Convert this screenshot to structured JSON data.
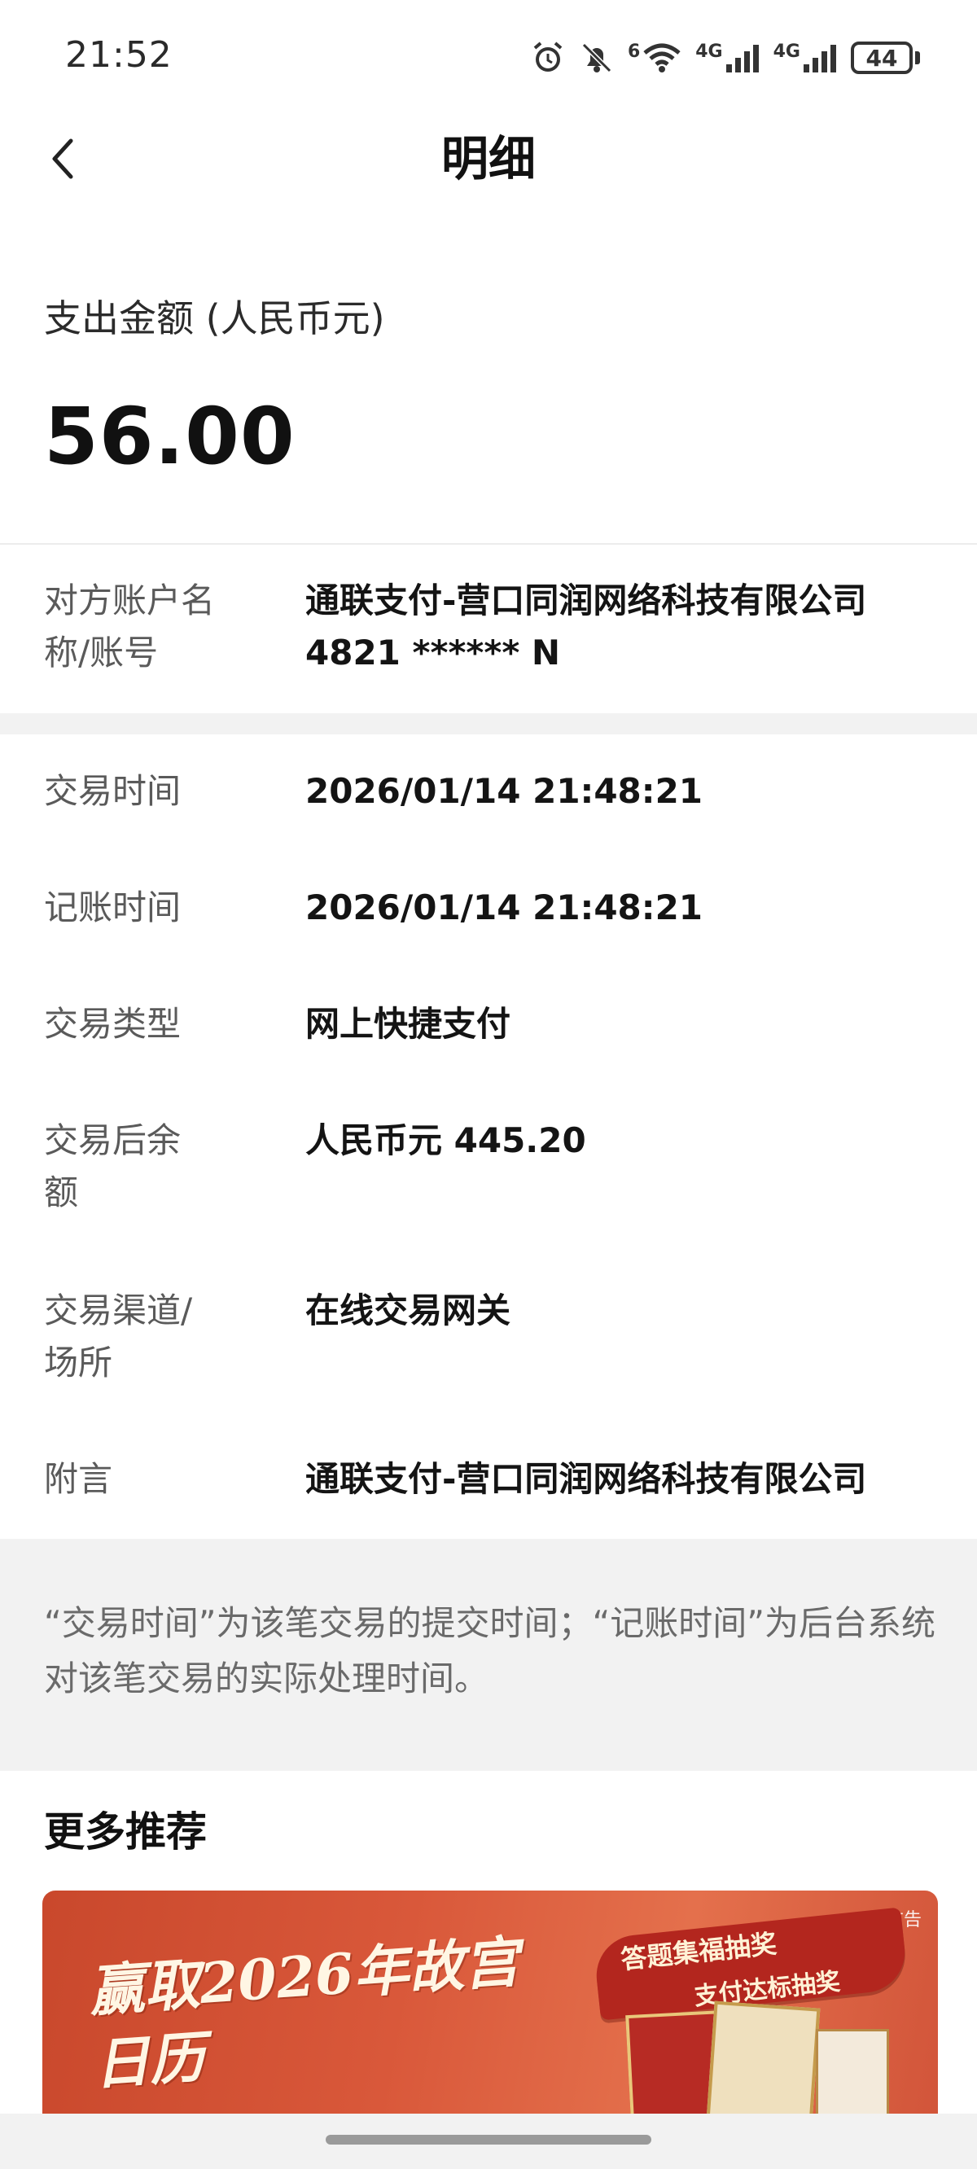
{
  "status_bar": {
    "time": "21:52",
    "icons": [
      "alarm-icon",
      "bell-off-icon",
      "wifi-icon",
      "signal-4g-icon",
      "signal-4g-icon",
      "battery-icon"
    ],
    "wifi_label": "6",
    "signal1_label": "4G",
    "signal2_label": "4G",
    "battery_level": "44"
  },
  "nav": {
    "back_icon": "chevron-left-icon",
    "title": "明细"
  },
  "amount": {
    "label": "支出金额 (人民币元)",
    "value": "56.00"
  },
  "counterparty": {
    "label": "对方账户名称/账号",
    "name": "通联支付-营口同润网络科技有限公司",
    "account": "4821 ****** N"
  },
  "details": [
    {
      "label": "交易时间",
      "value": "2026/01/14 21:48:21"
    },
    {
      "label": "记账时间",
      "value": "2026/01/14 21:48:21"
    },
    {
      "label": "交易类型",
      "value": "网上快捷支付"
    },
    {
      "label": "交易后余额",
      "value": "人民币元 445.20"
    },
    {
      "label": "交易渠道/场所",
      "value": "在线交易网关"
    },
    {
      "label": "附言",
      "value": "通联支付-营口同润网络科技有限公司"
    }
  ],
  "note": "“交易时间”为该笔交易的提交时间；“记账时间”为后台系统对该笔交易的实际处理时间。",
  "more": {
    "title": "更多推荐",
    "banner": {
      "ad_tag": "广告",
      "headline": "赢取2026年故宫日历",
      "ribbon_line1": "答题集福抽奖",
      "ribbon_line2": "支付达标抽奖"
    }
  },
  "colors": {
    "banner": "#d9583a",
    "ribbon": "#b3261e",
    "text_primary": "#141414",
    "text_secondary": "#5a5a5a",
    "band": "#f2f2f2"
  }
}
